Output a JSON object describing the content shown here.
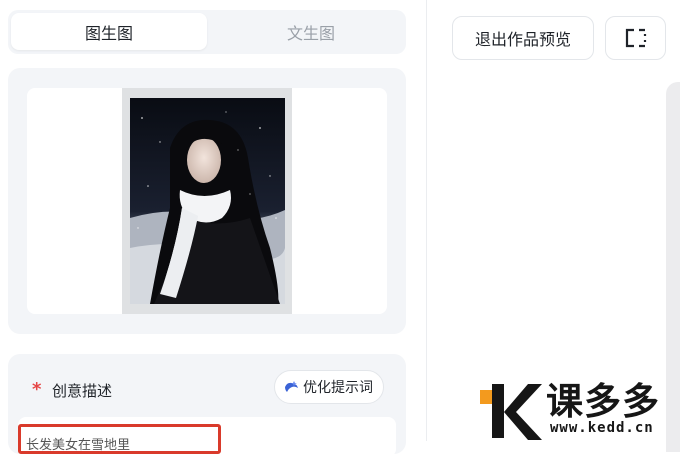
{
  "tabs": [
    {
      "label": "图生图",
      "active": true
    },
    {
      "label": "文生图",
      "active": false
    }
  ],
  "image_panel": {
    "image_alt": "woman in white scarf, snowy night"
  },
  "description": {
    "required_mark": "*",
    "label": "创意描述",
    "optimize_label": "优化提示词",
    "input_value": "长发美女在雪地里"
  },
  "toolbar": {
    "exit_label": "退出作品预览",
    "fullscreen_icon": "fullscreen-icon"
  },
  "watermark": {
    "brand": "课多多",
    "url": "www.kedd.cn"
  },
  "colors": {
    "accent_red": "#d93a2b",
    "required_red": "#e54545",
    "wm_orange": "#f39a1e"
  }
}
